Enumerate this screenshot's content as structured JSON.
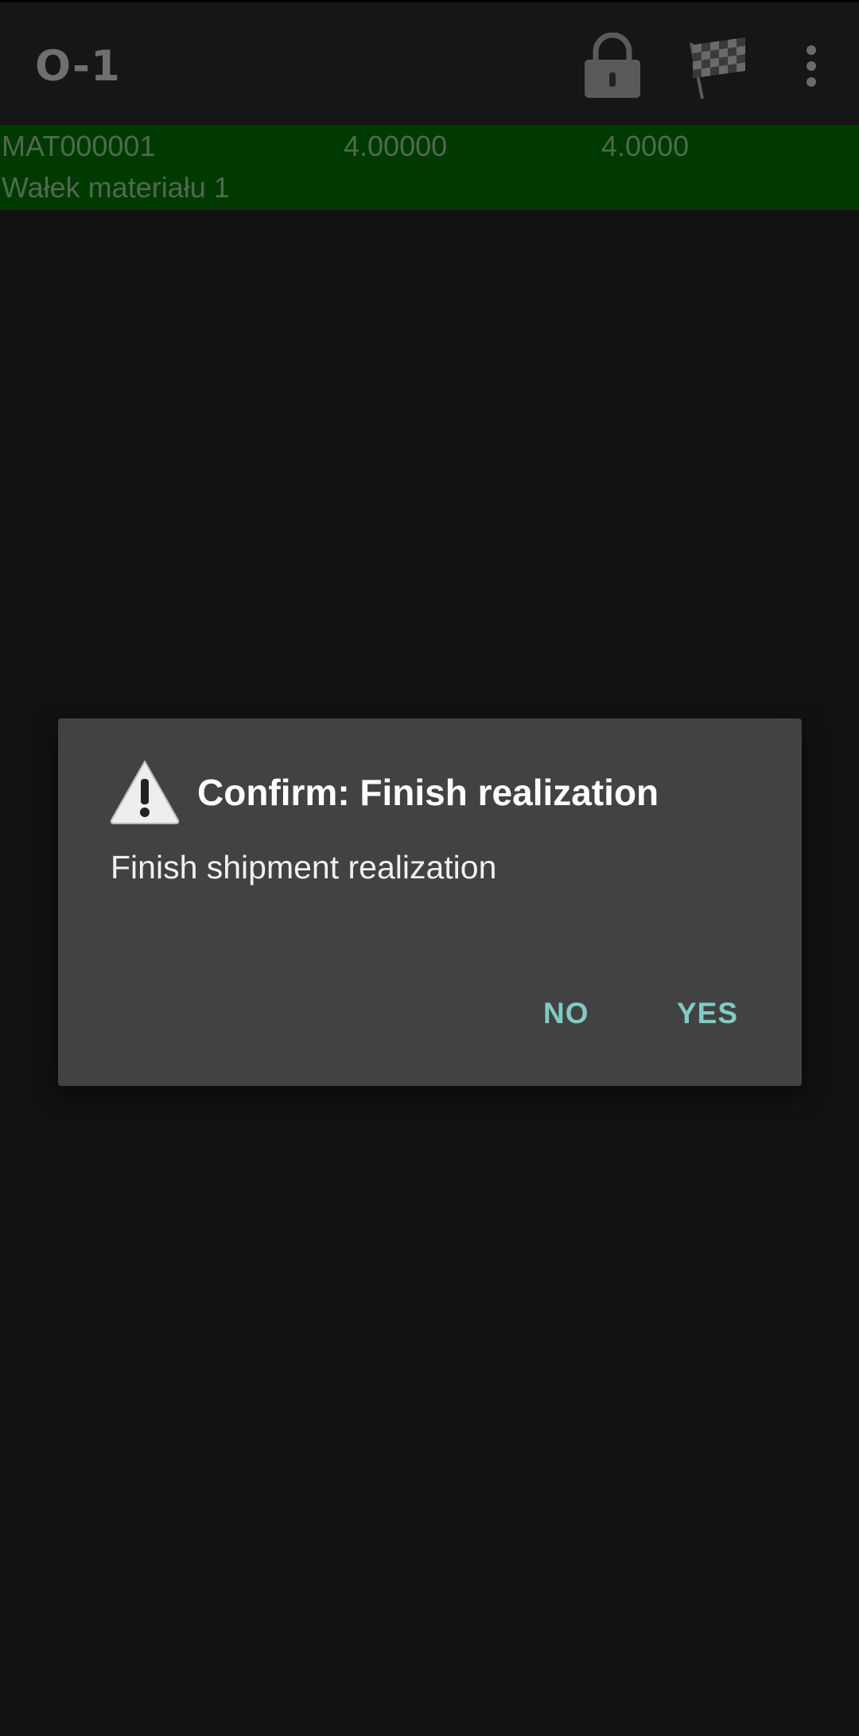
{
  "toolbar": {
    "title": "O-1",
    "actions": [
      {
        "icon": "lock-icon"
      },
      {
        "icon": "checkered-flag-icon"
      },
      {
        "icon": "more-vert-icon"
      }
    ]
  },
  "list": {
    "rows": [
      {
        "code": "MAT000001",
        "quantity_1": "4.00000",
        "quantity_2": "4.0000",
        "name": "Wałek materiału 1",
        "highlight_color": "#003a00"
      }
    ]
  },
  "dialog": {
    "icon": "warning-icon",
    "title": "Confirm: Finish realization",
    "message": "Finish shipment realization",
    "no_label": "NO",
    "yes_label": "YES",
    "accent_color": "#80cbc4"
  }
}
